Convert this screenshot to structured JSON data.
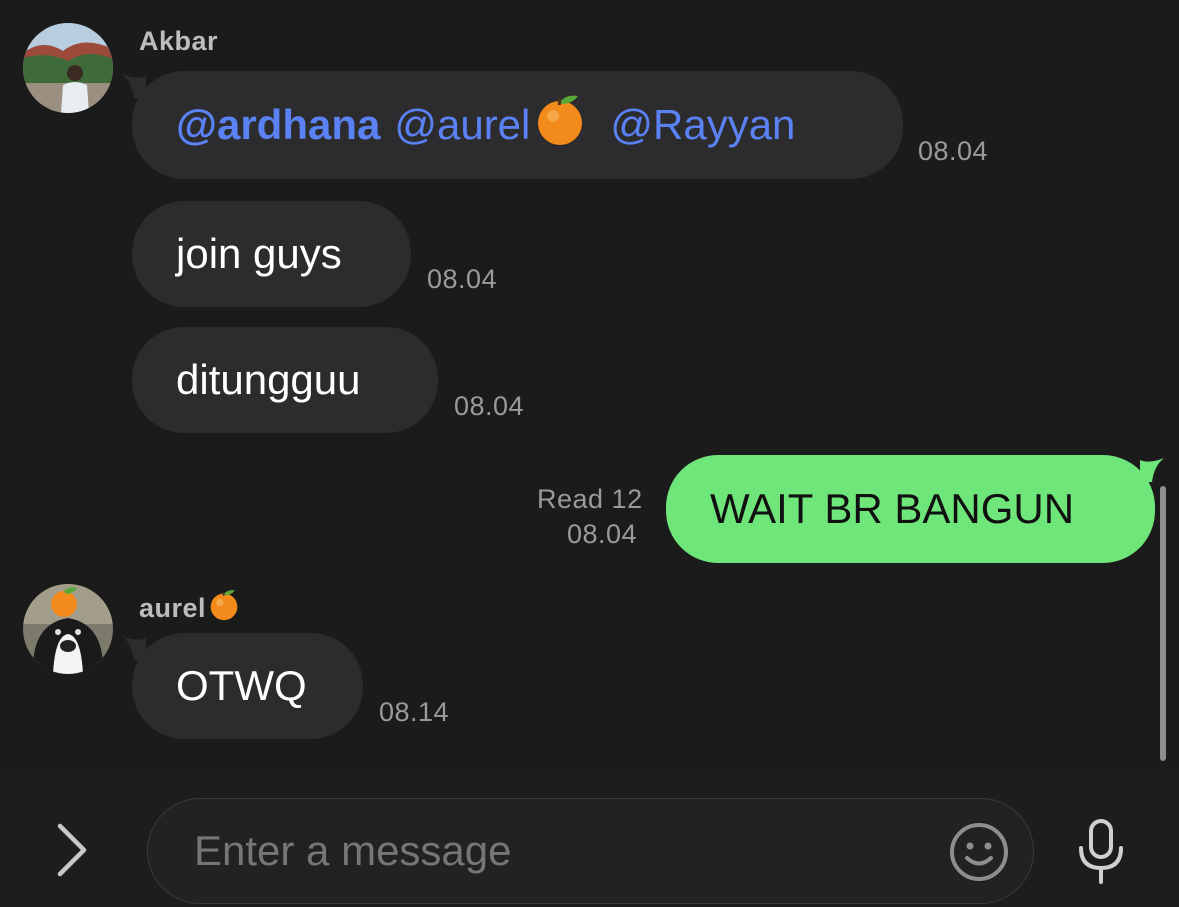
{
  "messages": [
    {
      "sender": "Akbar",
      "mentions": [
        "@ardhana",
        "@aurel",
        "@Rayyan"
      ],
      "time": "08.04"
    },
    {
      "text": "join guys",
      "time": "08.04"
    },
    {
      "text": "ditungguu",
      "time": "08.04"
    },
    {
      "text": "WAIT BR BANGUN",
      "read_status": "Read 12",
      "time": "08.04"
    },
    {
      "sender": "aurel",
      "text": "OTWQ",
      "time": "08.14"
    }
  ],
  "composer": {
    "placeholder": "Enter a message"
  },
  "icons": {
    "expand": "chevron-right-icon",
    "emoji": "smiley-icon",
    "voice": "microphone-icon",
    "tangerine": "tangerine-emoji"
  },
  "colors": {
    "background": "#1b1b1b",
    "incoming_bubble": "#2c2c2e",
    "outgoing_bubble": "#6ee67a",
    "mention": "#5b82f5",
    "timestamp": "#9a9a9a"
  }
}
